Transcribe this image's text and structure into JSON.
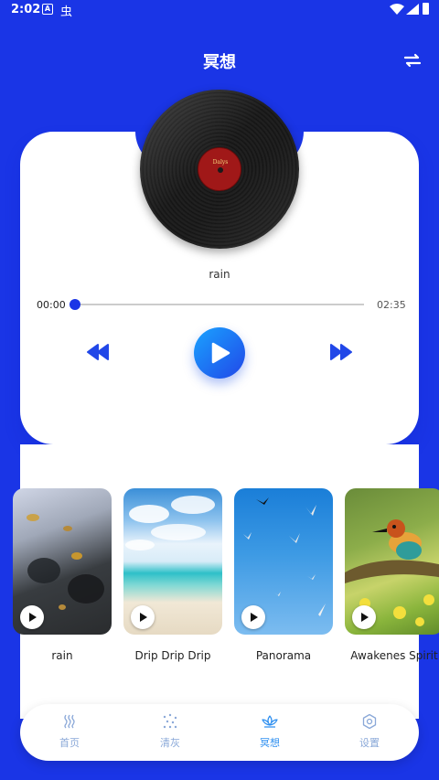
{
  "status": {
    "time": "2:02"
  },
  "header": {
    "title": "冥想"
  },
  "player": {
    "track": "rain",
    "time_current": "00:00",
    "time_total": "02:35",
    "progress": 0,
    "vinyl_label": "Dalys"
  },
  "scenes": [
    {
      "label": "rain",
      "image": "rain"
    },
    {
      "label": "Drip Drip Drip",
      "image": "beach"
    },
    {
      "label": "Panorama",
      "image": "sky-birds"
    },
    {
      "label": "Awakenes Spirit",
      "image": "bee-eater-bird"
    }
  ],
  "nav": [
    {
      "label": "首页",
      "icon": "wave-lines-icon",
      "active": false
    },
    {
      "label": "清灰",
      "icon": "dots-icon",
      "active": false
    },
    {
      "label": "冥想",
      "icon": "lotus-icon",
      "active": true
    },
    {
      "label": "设置",
      "icon": "gear-icon",
      "active": false
    }
  ],
  "colors": {
    "background": "#1a35e6",
    "accent": "#2e8ff0",
    "play_gradient": [
      "#1aa3ff",
      "#2147e8"
    ]
  }
}
